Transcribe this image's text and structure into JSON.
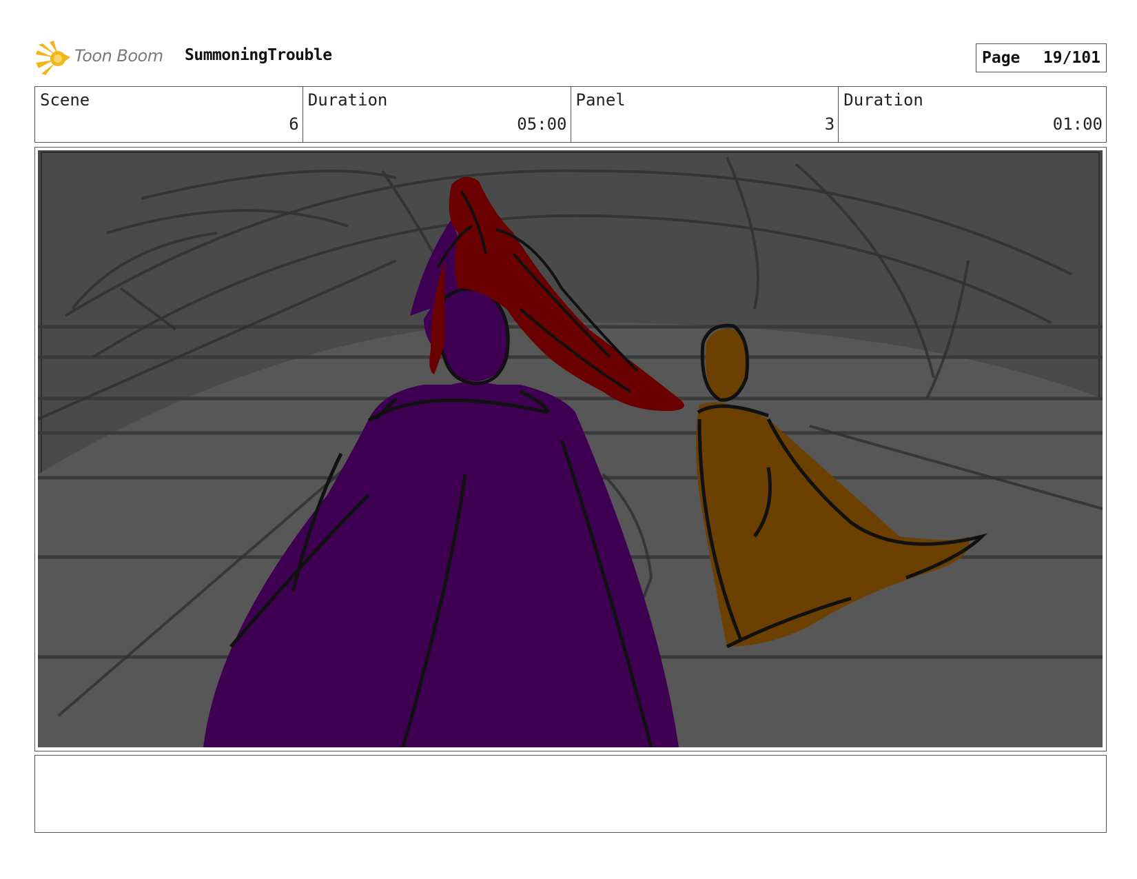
{
  "header": {
    "logo_text": "Toon Boom",
    "logo_icon": "toon-boom-burst-icon",
    "project_title": "SummoningTrouble",
    "page_label": "Page",
    "page_value": "19/101"
  },
  "info": {
    "scene_label": "Scene",
    "scene_value": "6",
    "scene_duration_label": "Duration",
    "scene_duration_value": "05:00",
    "panel_label": "Panel",
    "panel_value": "3",
    "panel_duration_label": "Duration",
    "panel_duration_value": "01:00"
  },
  "panel": {
    "colors": {
      "background": "#4a4a4a",
      "purple_figure": "#3f0054",
      "red_figure": "#6b0000",
      "orange_figure": "#6b4000",
      "line": "#111111"
    }
  },
  "notes": {
    "text": ""
  }
}
